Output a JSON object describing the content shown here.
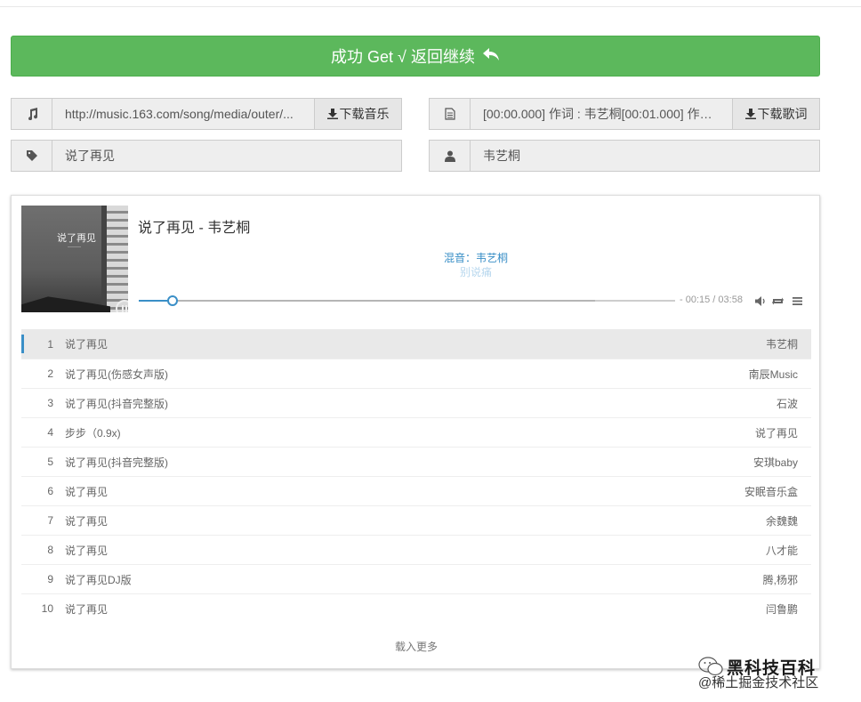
{
  "banner": {
    "label": "成功 Get √ 返回继续",
    "color": "#5cb85c"
  },
  "music_url": {
    "icon": "music-note-icon",
    "value": "http://music.163.com/song/media/outer/...",
    "button": "下载音乐"
  },
  "lyrics": {
    "icon": "document-icon",
    "value": "[00:00.000] 作词 : 韦艺桐[00:01.000] 作曲 ...",
    "button": "下载歌词"
  },
  "song_name": {
    "icon": "tag-icon",
    "value": "说了再见"
  },
  "artist": {
    "icon": "user-icon",
    "value": "韦艺桐"
  },
  "player": {
    "cover_title": "说了再见",
    "title": "说了再见 - 韦艺桐",
    "lyric_current": "混音：韦艺桐",
    "lyric_next": "别说痛",
    "time": "- 00:15 / 03:58",
    "progress": 0.063,
    "loaded": 0.85,
    "accent": "#3a8fc7",
    "controls": [
      "volume-icon",
      "loop-icon",
      "menu-icon"
    ]
  },
  "playlist": [
    {
      "num": "1",
      "title": "说了再见",
      "artist": "韦艺桐",
      "active": true
    },
    {
      "num": "2",
      "title": "说了再见(伤感女声版)",
      "artist": "南辰Music"
    },
    {
      "num": "3",
      "title": "说了再见(抖音完整版)",
      "artist": "石波"
    },
    {
      "num": "4",
      "title": "步步（0.9x)",
      "artist": "说了再见"
    },
    {
      "num": "5",
      "title": "说了再见(抖音完整版)",
      "artist": "安琪baby"
    },
    {
      "num": "6",
      "title": "说了再见",
      "artist": "安眠音乐盒"
    },
    {
      "num": "7",
      "title": "说了再见",
      "artist": "余魏魏"
    },
    {
      "num": "8",
      "title": "说了再见",
      "artist": "八才能"
    },
    {
      "num": "9",
      "title": "说了再见DJ版",
      "artist": "腾,杨邪"
    },
    {
      "num": "10",
      "title": "说了再见",
      "artist": "闫鲁鹏"
    }
  ],
  "load_more": "载入更多",
  "watermark": {
    "line1": "黑科技百科",
    "line2": "@稀土掘金技术社区"
  }
}
